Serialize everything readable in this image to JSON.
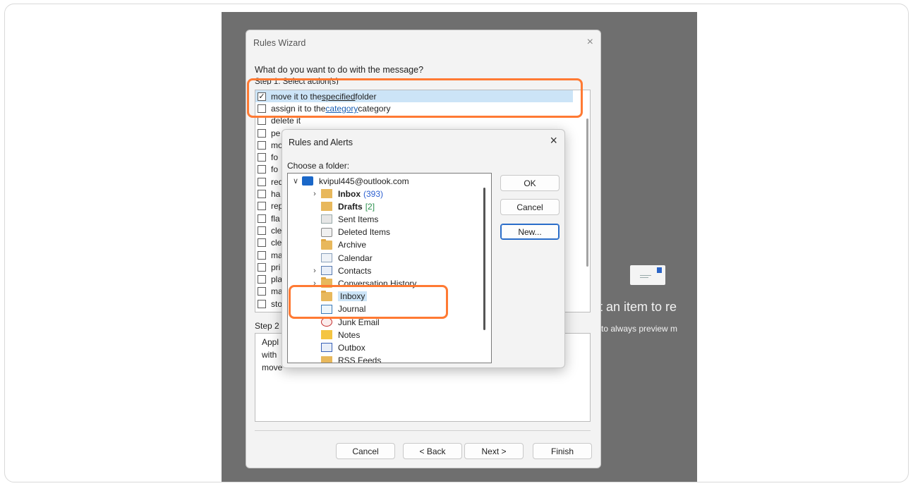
{
  "reading_pane": {
    "title": "ect an item to re",
    "subtitle": "re to always preview m"
  },
  "wizard": {
    "title": "Rules Wizard",
    "close_glyph": "×",
    "question": "What do you want to do with the message?",
    "step1_label": "Step 1: Select action(s)",
    "actions": [
      {
        "checked": true,
        "pre": "move it to the ",
        "link": "specified",
        "post": " folder"
      },
      {
        "checked": false,
        "pre": "assign it to the ",
        "link": "category",
        "post": " category"
      },
      {
        "checked": false,
        "pre": "delete it",
        "link": "",
        "post": ""
      },
      {
        "checked": false,
        "pre": "pe",
        "link": "",
        "post": ""
      },
      {
        "checked": false,
        "pre": "mo",
        "link": "",
        "post": ""
      },
      {
        "checked": false,
        "pre": "fo",
        "link": "",
        "post": ""
      },
      {
        "checked": false,
        "pre": "fo",
        "link": "",
        "post": ""
      },
      {
        "checked": false,
        "pre": "red",
        "link": "",
        "post": ""
      },
      {
        "checked": false,
        "pre": "ha",
        "link": "",
        "post": ""
      },
      {
        "checked": false,
        "pre": "rep",
        "link": "",
        "post": ""
      },
      {
        "checked": false,
        "pre": "fla",
        "link": "",
        "post": ""
      },
      {
        "checked": false,
        "pre": "cle",
        "link": "",
        "post": ""
      },
      {
        "checked": false,
        "pre": "cle",
        "link": "",
        "post": ""
      },
      {
        "checked": false,
        "pre": "ma",
        "link": "",
        "post": ""
      },
      {
        "checked": false,
        "pre": "pri",
        "link": "",
        "post": ""
      },
      {
        "checked": false,
        "pre": "pla",
        "link": "",
        "post": ""
      },
      {
        "checked": false,
        "pre": "ma",
        "link": "",
        "post": ""
      },
      {
        "checked": false,
        "pre": "sto",
        "link": "",
        "post": ""
      }
    ],
    "step2_label": "Step 2",
    "description_lines": [
      "Appl",
      "with",
      "move"
    ],
    "buttons": {
      "cancel": "Cancel",
      "back": "< Back",
      "next": "Next >",
      "finish": "Finish"
    }
  },
  "alerts": {
    "title": "Rules and Alerts",
    "close_glyph": "×",
    "choose_label": "Choose a folder:",
    "account": "kvipul445@outlook.com",
    "folders": [
      {
        "name": "Inbox",
        "count": "(393)",
        "count_color": "blue",
        "bold": true,
        "expander": true,
        "icon": "inbox-icon"
      },
      {
        "name": "Drafts",
        "count": "[2]",
        "count_color": "green",
        "bold": true,
        "expander": false,
        "icon": "drafts-icon"
      },
      {
        "name": "Sent Items",
        "count": "",
        "bold": false,
        "expander": false,
        "icon": "sent-items-icon"
      },
      {
        "name": "Deleted Items",
        "count": "",
        "bold": false,
        "expander": false,
        "icon": "trash-icon"
      },
      {
        "name": "Archive",
        "count": "",
        "bold": false,
        "expander": false,
        "icon": "folder-icon"
      },
      {
        "name": "Calendar",
        "count": "",
        "bold": false,
        "expander": false,
        "icon": "calendar-icon"
      },
      {
        "name": "Contacts",
        "count": "",
        "bold": false,
        "expander": true,
        "icon": "contacts-icon"
      },
      {
        "name": "Conversation History",
        "count": "",
        "bold": false,
        "expander": true,
        "icon": "folder-icon"
      },
      {
        "name": "Inboxy",
        "count": "",
        "bold": false,
        "expander": false,
        "icon": "folder-icon",
        "selected": true
      },
      {
        "name": "Journal",
        "count": "",
        "bold": false,
        "expander": false,
        "icon": "journal-icon"
      },
      {
        "name": "Junk Email",
        "count": "",
        "bold": false,
        "expander": false,
        "icon": "junk-icon"
      },
      {
        "name": "Notes",
        "count": "",
        "bold": false,
        "expander": false,
        "icon": "notes-icon"
      },
      {
        "name": "Outbox",
        "count": "",
        "bold": false,
        "expander": false,
        "icon": "outbox-icon"
      },
      {
        "name": "RSS Feeds",
        "count": "",
        "bold": false,
        "expander": false,
        "icon": "rss-icon"
      }
    ],
    "buttons": {
      "ok": "OK",
      "cancel": "Cancel",
      "new": "New..."
    }
  },
  "colors": {
    "highlight": "#ff7a33",
    "selection": "#cce4f7",
    "link": "#1a5fb4",
    "backdrop": "#6f6f6f"
  }
}
